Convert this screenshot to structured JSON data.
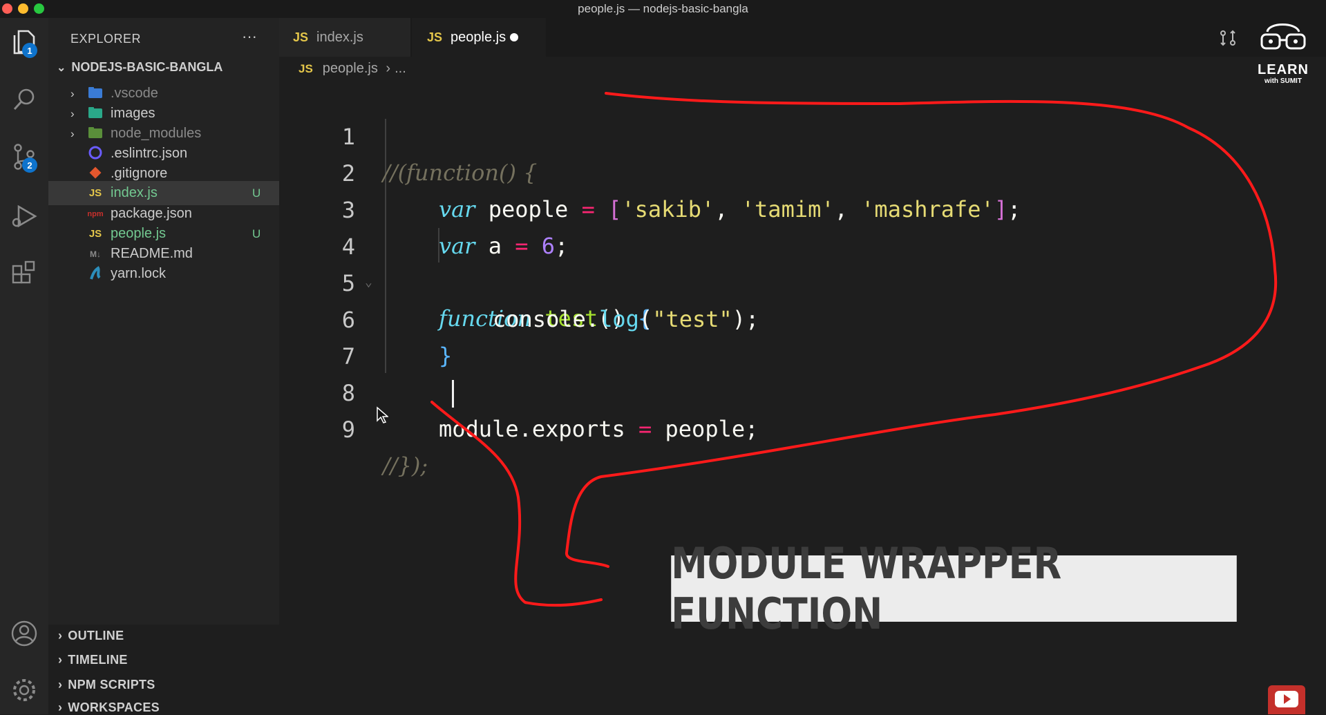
{
  "window": {
    "title": "people.js — nodejs-basic-bangla"
  },
  "activity_bar": {
    "explorer_badge": "1",
    "scm_badge": "2"
  },
  "explorer": {
    "title": "EXPLORER",
    "more": "···",
    "project": "NODEJS-BASIC-BANGLA",
    "items": [
      {
        "name": ".vscode",
        "type": "folder",
        "icon": "vscode-folder-icon",
        "status": ""
      },
      {
        "name": "images",
        "type": "folder",
        "icon": "images-folder-icon",
        "status": ""
      },
      {
        "name": "node_modules",
        "type": "folder",
        "icon": "node-folder-icon",
        "status": ""
      },
      {
        "name": ".eslintrc.json",
        "type": "file",
        "icon": "eslint-icon",
        "status": ""
      },
      {
        "name": ".gitignore",
        "type": "file",
        "icon": "git-icon",
        "status": ""
      },
      {
        "name": "index.js",
        "type": "file",
        "icon": "js-icon",
        "icon_text": "JS",
        "status": "U"
      },
      {
        "name": "package.json",
        "type": "file",
        "icon": "npm-icon",
        "icon_text": "npm",
        "status": ""
      },
      {
        "name": "people.js",
        "type": "file",
        "icon": "js-icon",
        "icon_text": "JS",
        "status": "U"
      },
      {
        "name": "README.md",
        "type": "file",
        "icon": "markdown-icon",
        "icon_text": "M↓",
        "status": ""
      },
      {
        "name": "yarn.lock",
        "type": "file",
        "icon": "yarn-icon",
        "status": ""
      }
    ],
    "sections": [
      "OUTLINE",
      "TIMELINE",
      "NPM SCRIPTS",
      "WORKSPACES"
    ]
  },
  "tabs": [
    {
      "label": "index.js",
      "icon_text": "JS",
      "active": false
    },
    {
      "label": "people.js",
      "icon_text": "JS",
      "active": true,
      "modified": true
    }
  ],
  "breadcrumb": {
    "icon_text": "JS",
    "file": "people.js",
    "sep": "›",
    "more": "..."
  },
  "editor": {
    "line_numbers": [
      "1",
      "2",
      "3",
      "4",
      "5",
      "6",
      "7",
      "8",
      "9"
    ],
    "code": {
      "l1": "//(function() {",
      "l2_kw": "var",
      "l2_name": "people",
      "l2_op": "=",
      "l2_s1": "'sakib'",
      "l2_s2": "'tamim'",
      "l2_s3": "'mashrafe'",
      "l3_kw": "var",
      "l3_name": "a",
      "l3_op": "=",
      "l3_num": "6",
      "l4_kw": "function",
      "l4_fn": "test",
      "l5_obj": "console",
      "l5_fn": "log",
      "l5_str": "\"test\"",
      "l8_obj": "module",
      "l8_prop": "exports",
      "l8_op": "=",
      "l8_val": "people",
      "l9": "//});"
    }
  },
  "caption": "MODULE WRAPPER FUNCTION",
  "logo": {
    "line1": "LEARN",
    "line2": "with SUMIT"
  },
  "colors": {
    "annotation": "#ff1a1a",
    "js": "#e4c64a",
    "untracked": "#73c991"
  }
}
